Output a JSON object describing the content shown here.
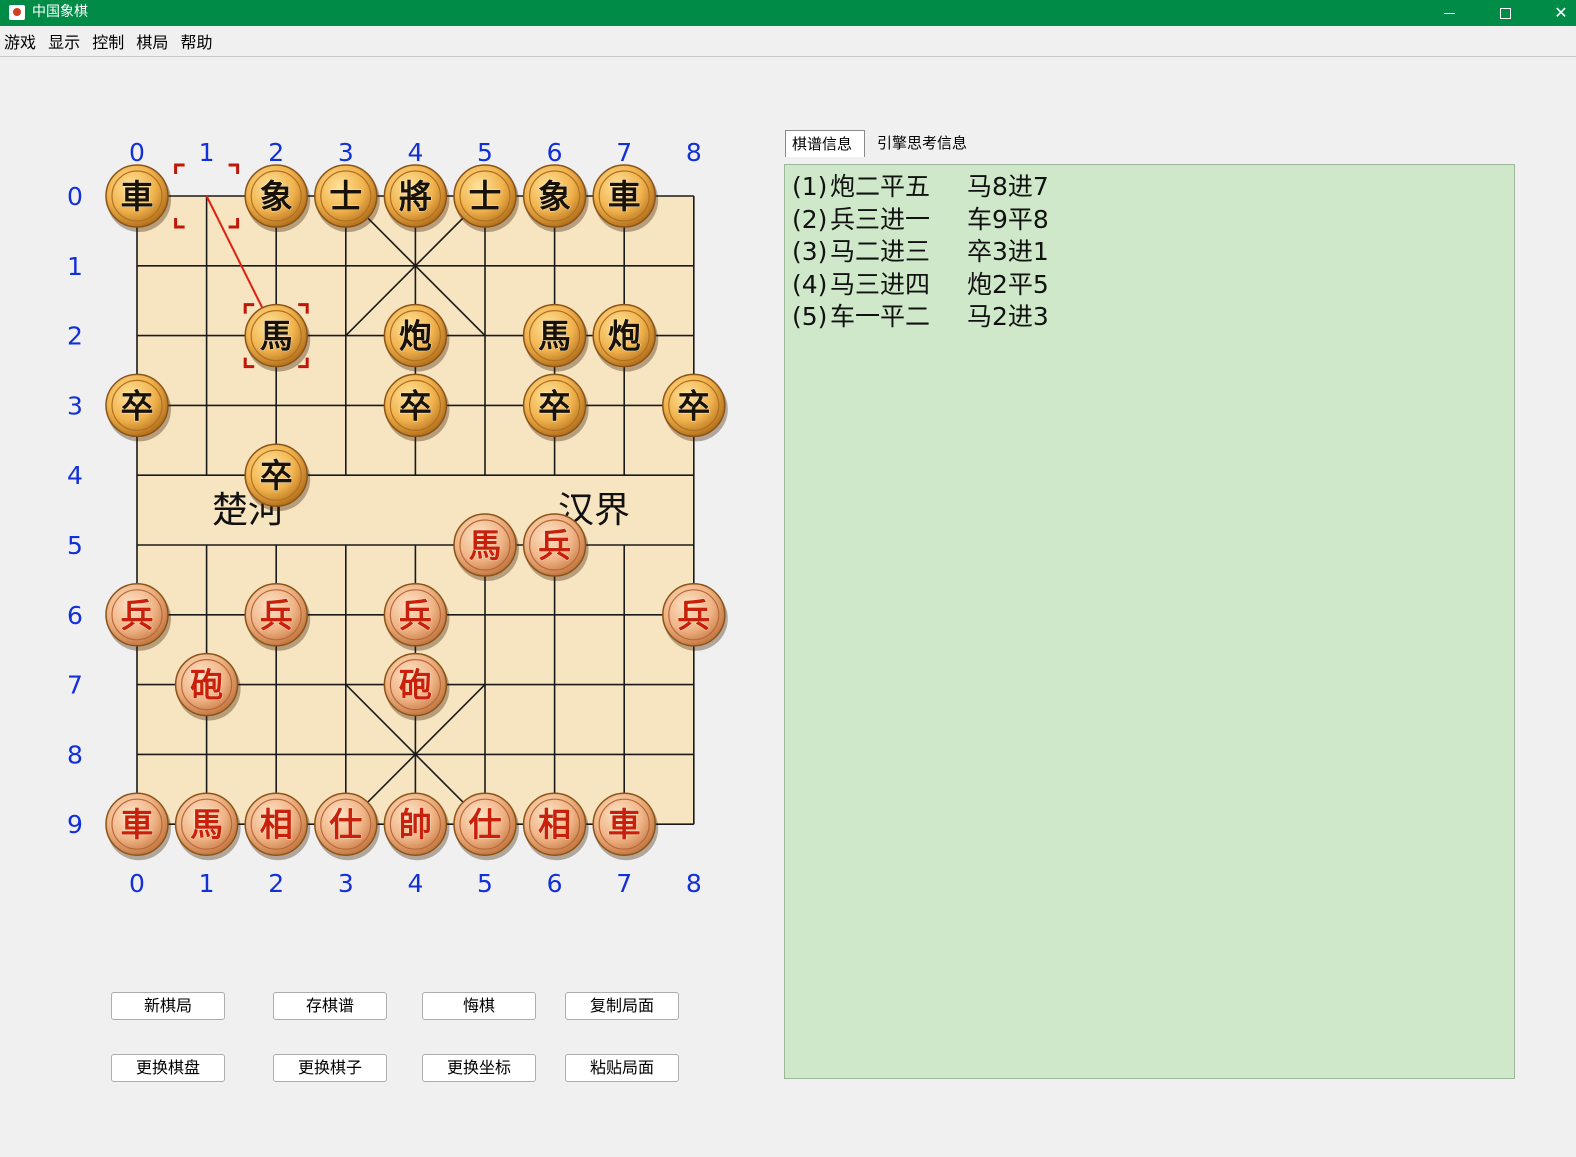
{
  "window": {
    "title": "中国象棋",
    "controls": [
      "minimize-icon",
      "maximize-icon",
      "close-icon"
    ]
  },
  "menu": [
    "游戏",
    "显示",
    "控制",
    "棋局",
    "帮助"
  ],
  "board": {
    "columns_top": [
      "0",
      "1",
      "2",
      "3",
      "4",
      "5",
      "6",
      "7",
      "8"
    ],
    "columns_bottom": [
      "0",
      "1",
      "2",
      "3",
      "4",
      "5",
      "6",
      "7",
      "8"
    ],
    "rows": [
      "0",
      "1",
      "2",
      "3",
      "4",
      "5",
      "6",
      "7",
      "8",
      "9"
    ],
    "river_left": "楚河",
    "river_right": "汉界",
    "last_move": {
      "from": [
        1,
        0
      ],
      "to": [
        2,
        2
      ]
    },
    "pieces": [
      {
        "char": "車",
        "side": "black",
        "col": 0,
        "row": 0
      },
      {
        "char": "象",
        "side": "black",
        "col": 2,
        "row": 0
      },
      {
        "char": "士",
        "side": "black",
        "col": 3,
        "row": 0
      },
      {
        "char": "將",
        "side": "black",
        "col": 4,
        "row": 0
      },
      {
        "char": "士",
        "side": "black",
        "col": 5,
        "row": 0
      },
      {
        "char": "象",
        "side": "black",
        "col": 6,
        "row": 0
      },
      {
        "char": "車",
        "side": "black",
        "col": 7,
        "row": 0
      },
      {
        "char": "馬",
        "side": "black",
        "col": 2,
        "row": 2
      },
      {
        "char": "炮",
        "side": "black",
        "col": 4,
        "row": 2
      },
      {
        "char": "馬",
        "side": "black",
        "col": 6,
        "row": 2
      },
      {
        "char": "炮",
        "side": "black",
        "col": 7,
        "row": 2
      },
      {
        "char": "卒",
        "side": "black",
        "col": 0,
        "row": 3
      },
      {
        "char": "卒",
        "side": "black",
        "col": 4,
        "row": 3
      },
      {
        "char": "卒",
        "side": "black",
        "col": 6,
        "row": 3
      },
      {
        "char": "卒",
        "side": "black",
        "col": 8,
        "row": 3
      },
      {
        "char": "卒",
        "side": "black",
        "col": 2,
        "row": 4
      },
      {
        "char": "馬",
        "side": "red",
        "col": 5,
        "row": 5
      },
      {
        "char": "兵",
        "side": "red",
        "col": 6,
        "row": 5
      },
      {
        "char": "兵",
        "side": "red",
        "col": 0,
        "row": 6
      },
      {
        "char": "兵",
        "side": "red",
        "col": 2,
        "row": 6
      },
      {
        "char": "兵",
        "side": "red",
        "col": 4,
        "row": 6
      },
      {
        "char": "兵",
        "side": "red",
        "col": 8,
        "row": 6
      },
      {
        "char": "砲",
        "side": "red",
        "col": 1,
        "row": 7
      },
      {
        "char": "砲",
        "side": "red",
        "col": 4,
        "row": 7
      },
      {
        "char": "車",
        "side": "red",
        "col": 0,
        "row": 9
      },
      {
        "char": "馬",
        "side": "red",
        "col": 1,
        "row": 9
      },
      {
        "char": "相",
        "side": "red",
        "col": 2,
        "row": 9
      },
      {
        "char": "仕",
        "side": "red",
        "col": 3,
        "row": 9
      },
      {
        "char": "帥",
        "side": "red",
        "col": 4,
        "row": 9
      },
      {
        "char": "仕",
        "side": "red",
        "col": 5,
        "row": 9
      },
      {
        "char": "相",
        "side": "red",
        "col": 6,
        "row": 9
      },
      {
        "char": "車",
        "side": "red",
        "col": 7,
        "row": 9
      }
    ]
  },
  "tabs": [
    "棋谱信息",
    "引擎思考信息"
  ],
  "moves": [
    {
      "num": "(1)",
      "red": "炮二平五",
      "black": "马8进7"
    },
    {
      "num": "(2)",
      "red": "兵三进一",
      "black": "车9平8"
    },
    {
      "num": "(3)",
      "red": "马二进三",
      "black": "卒3进1"
    },
    {
      "num": "(4)",
      "red": "马三进四",
      "black": "炮2平5"
    },
    {
      "num": "(5)",
      "red": "车一平二",
      "black": "马2进3"
    }
  ],
  "buttons": {
    "row1": [
      "新棋局",
      "存棋谱",
      "悔棋",
      "复制局面"
    ],
    "row2": [
      "更换棋盘",
      "更换棋子",
      "更换坐标",
      "粘贴局面"
    ]
  },
  "colors": {
    "titlebar": "#008b47",
    "board": "#f7e4c0",
    "coords": "#1230d8",
    "record_panel": "#cfe8c9",
    "red_piece_text": "#c8200a",
    "black_piece_text": "#1a1206"
  }
}
